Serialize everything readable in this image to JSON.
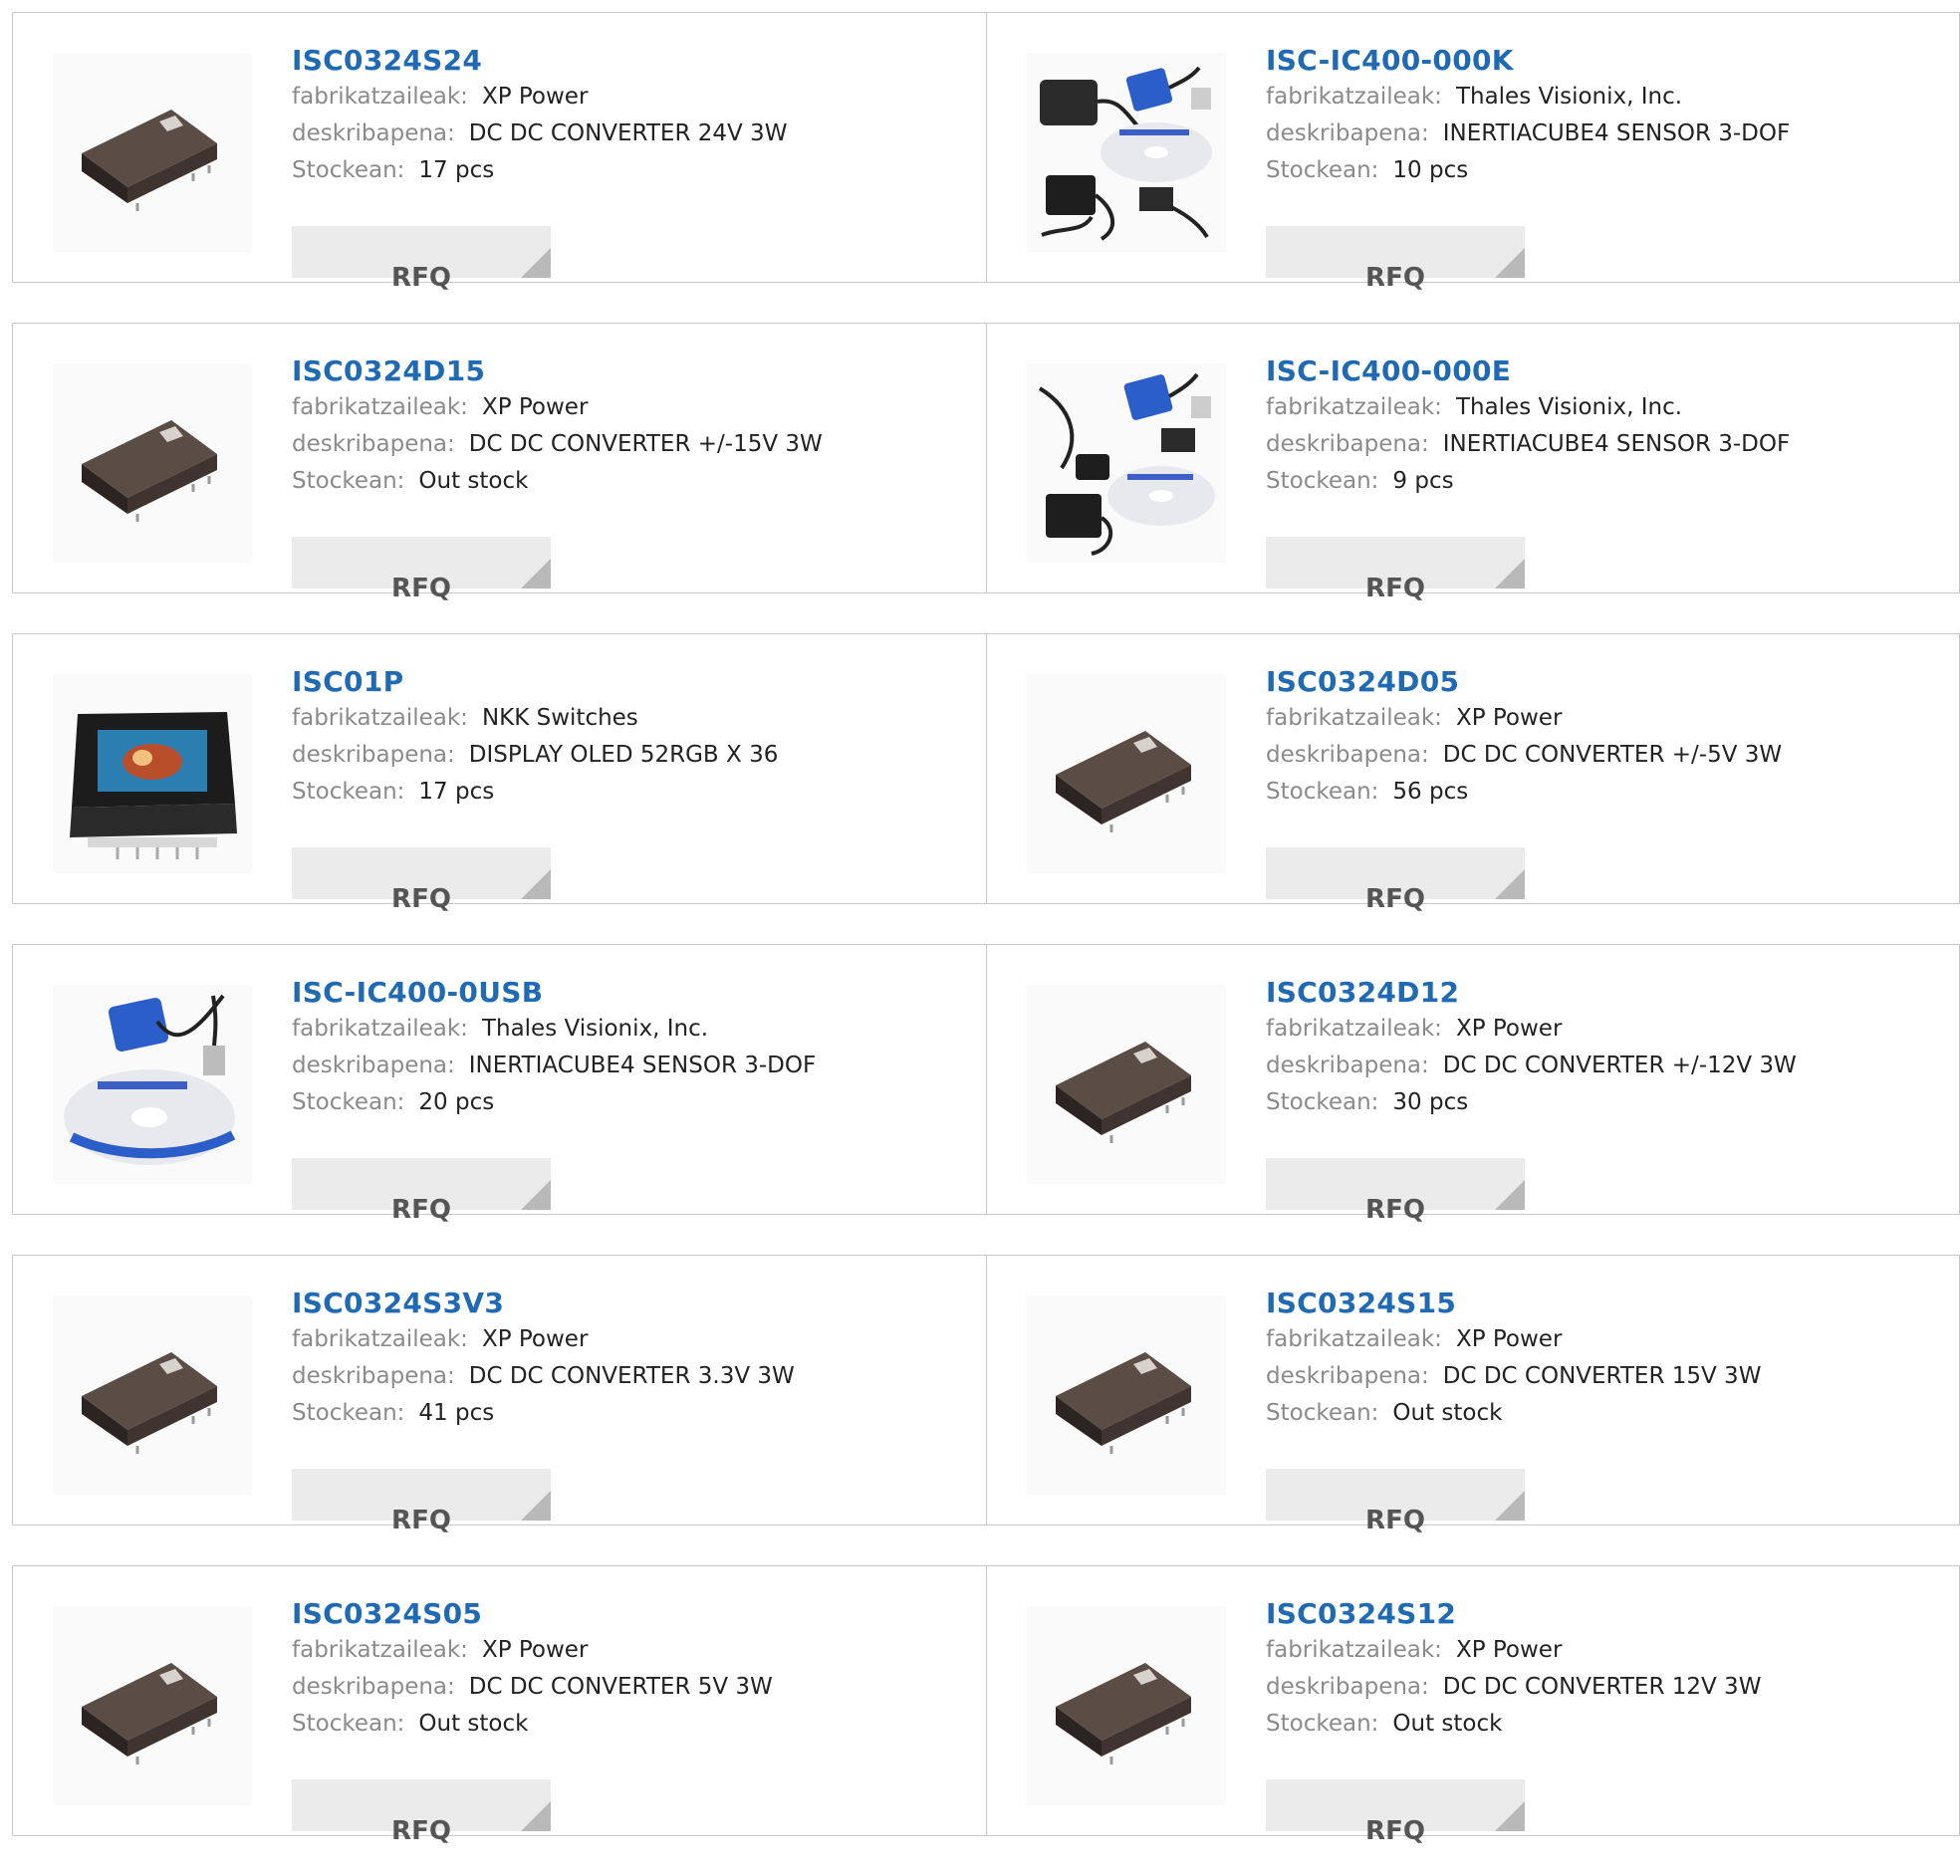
{
  "labels": {
    "manufacturer": "fabrikatzaileak:",
    "description": "deskribapena:",
    "stock": "Stockean:",
    "rfq": "RFQ"
  },
  "products": [
    {
      "name": "ISC0324S24",
      "manufacturer": "XP Power",
      "description": "DC DC CONVERTER 24V 3W",
      "stock": "17 pcs",
      "image": "dc-converter-module"
    },
    {
      "name": "ISC-IC400-000K",
      "manufacturer": "Thales Visionix, Inc.",
      "description": "INERTIACUBE4 SENSOR 3-DOF",
      "stock": "10 pcs",
      "image": "sensor-kit-uk"
    },
    {
      "name": "ISC0324D15",
      "manufacturer": "XP Power",
      "description": "DC DC CONVERTER +/-15V 3W",
      "stock": "Out stock",
      "image": "dc-converter-module"
    },
    {
      "name": "ISC-IC400-000E",
      "manufacturer": "Thales Visionix, Inc.",
      "description": "INERTIACUBE4 SENSOR 3-DOF",
      "stock": "9 pcs",
      "image": "sensor-kit-eu"
    },
    {
      "name": "ISC01P",
      "manufacturer": "NKK Switches",
      "description": "DISPLAY OLED 52RGB X 36",
      "stock": "17 pcs",
      "image": "oled-display-switch"
    },
    {
      "name": "ISC0324D05",
      "manufacturer": "XP Power",
      "description": "DC DC CONVERTER +/-5V 3W",
      "stock": "56 pcs",
      "image": "dc-converter-module"
    },
    {
      "name": "ISC-IC400-0USB",
      "manufacturer": "Thales Visionix, Inc.",
      "description": "INERTIACUBE4 SENSOR 3-DOF",
      "stock": "20 pcs",
      "image": "sensor-kit-usb"
    },
    {
      "name": "ISC0324D12",
      "manufacturer": "XP Power",
      "description": "DC DC CONVERTER +/-12V 3W",
      "stock": "30 pcs",
      "image": "dc-converter-module"
    },
    {
      "name": "ISC0324S3V3",
      "manufacturer": "XP Power",
      "description": "DC DC CONVERTER 3.3V 3W",
      "stock": "41 pcs",
      "image": "dc-converter-module"
    },
    {
      "name": "ISC0324S15",
      "manufacturer": "XP Power",
      "description": "DC DC CONVERTER 15V 3W",
      "stock": "Out stock",
      "image": "dc-converter-module"
    },
    {
      "name": "ISC0324S05",
      "manufacturer": "XP Power",
      "description": "DC DC CONVERTER 5V 3W",
      "stock": "Out stock",
      "image": "dc-converter-module"
    },
    {
      "name": "ISC0324S12",
      "manufacturer": "XP Power",
      "description": "DC DC CONVERTER 12V 3W",
      "stock": "Out stock",
      "image": "dc-converter-module"
    }
  ],
  "colors": {
    "link": "#1f6ab3",
    "label": "#8a8a8a",
    "value": "#222222",
    "border": "#c8c8c8",
    "button_bg": "#ebebeb",
    "button_corner": "#b9b9b9"
  }
}
